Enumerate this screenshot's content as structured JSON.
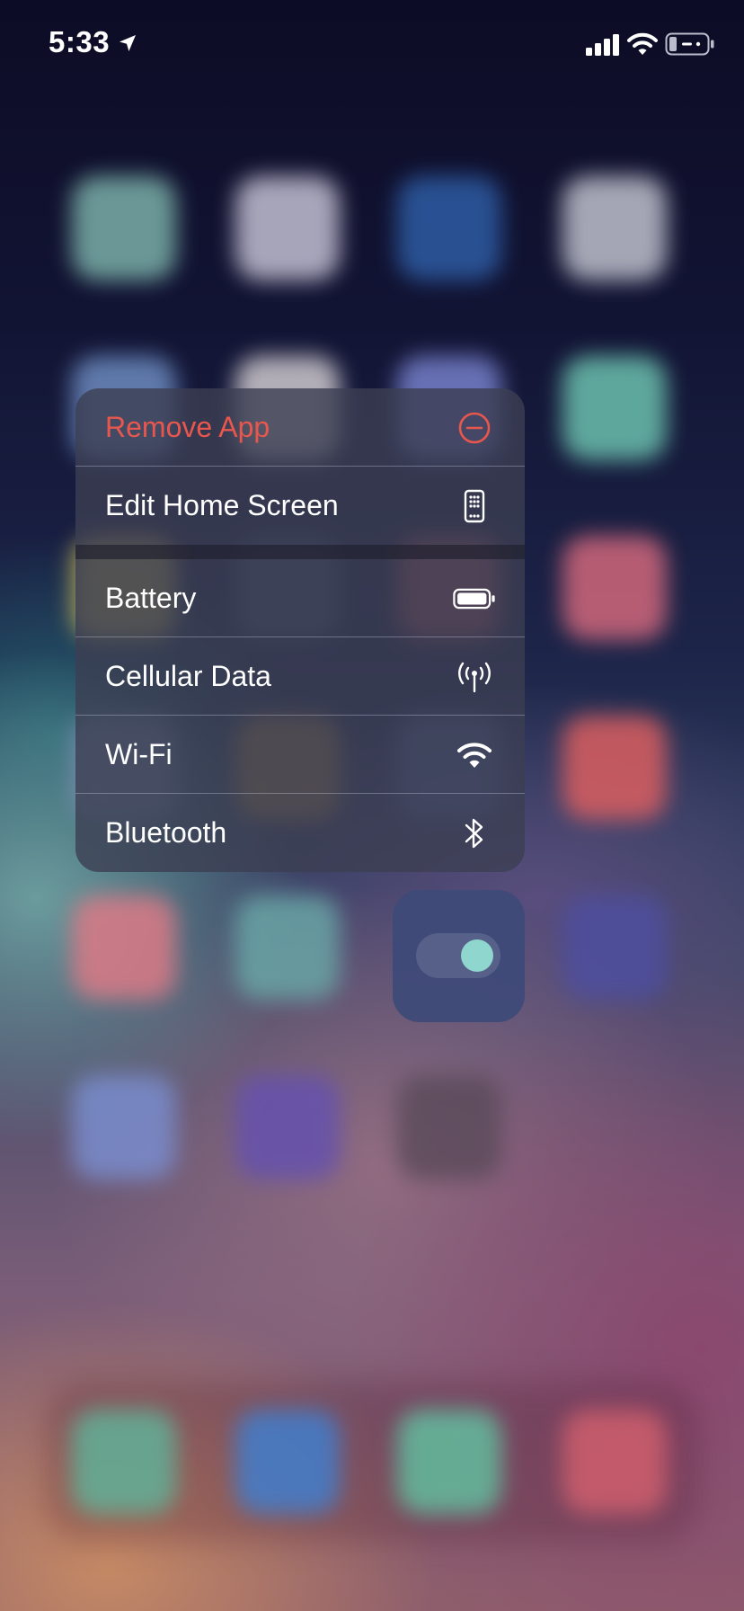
{
  "status_bar": {
    "time": "5:33",
    "location_icon": "location-arrow-icon",
    "signal_icon": "cellular-signal-icon",
    "wifi_icon": "wifi-icon",
    "battery_icon": "battery-icon"
  },
  "context_menu": {
    "remove_app": {
      "label": "Remove App",
      "icon": "minus-circle-icon",
      "color": "#e8574e"
    },
    "edit_home_screen": {
      "label": "Edit Home Screen",
      "icon": "phone-apps-icon"
    },
    "quick_actions": [
      {
        "label": "Battery",
        "icon": "battery-icon"
      },
      {
        "label": "Cellular Data",
        "icon": "antenna-icon"
      },
      {
        "label": "Wi-Fi",
        "icon": "wifi-icon"
      },
      {
        "label": "Bluetooth",
        "icon": "bluetooth-icon"
      }
    ]
  },
  "widget_preview": {
    "icon": "toggle-switch-icon",
    "toggle_on": true,
    "accent_color": "#8fd6cf"
  },
  "colors": {
    "destructive": "#e8574e",
    "menu_text": "#ffffff"
  }
}
